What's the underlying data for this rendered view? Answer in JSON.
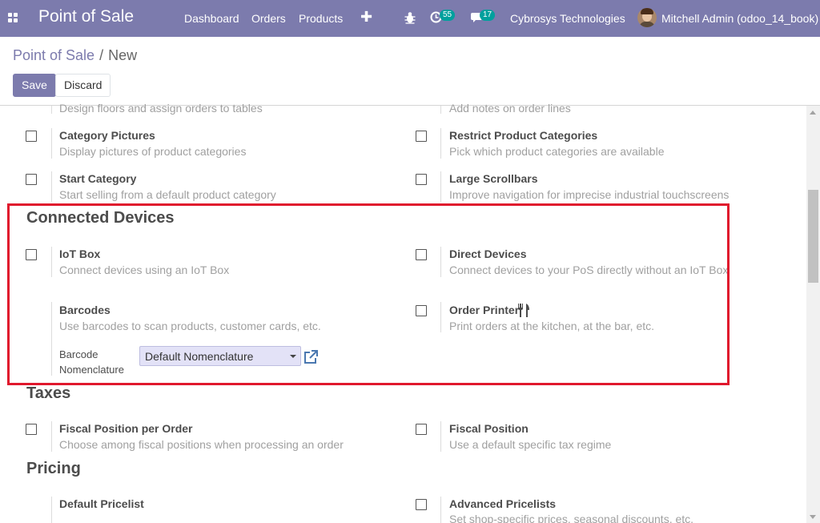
{
  "navbar": {
    "brand": "Point of Sale",
    "menu": [
      "Dashboard",
      "Orders",
      "Products"
    ],
    "activity_count": "55",
    "message_count": "17",
    "company": "Cybrosys Technologies",
    "user": "Mitchell Admin (odoo_14_book)"
  },
  "breadcrumb": {
    "parent": "Point of Sale",
    "separator": "/",
    "current": "New"
  },
  "buttons": {
    "save": "Save",
    "discard": "Discard"
  },
  "settings": {
    "floors_desc": "Design floors and assign orders to tables",
    "notes_desc": "Add notes on order lines",
    "category_pictures": {
      "title": "Category Pictures",
      "desc": "Display pictures of product categories"
    },
    "restrict_categories": {
      "title": "Restrict Product Categories",
      "desc": "Pick which product categories are available"
    },
    "start_category": {
      "title": "Start Category",
      "desc": "Start selling from a default product category"
    },
    "large_scrollbars": {
      "title": "Large Scrollbars",
      "desc": "Improve navigation for imprecise industrial touchscreens"
    }
  },
  "connected_devices": {
    "heading": "Connected Devices",
    "iot_box": {
      "title": "IoT Box",
      "desc": "Connect devices using an IoT Box"
    },
    "direct_devices": {
      "title": "Direct Devices",
      "desc": "Connect devices to your PoS directly without an IoT Box"
    },
    "barcodes": {
      "title": "Barcodes",
      "desc": "Use barcodes to scan products, customer cards, etc."
    },
    "order_printer": {
      "title": "Order Printer",
      "desc": "Print orders at the kitchen, at the bar, etc."
    },
    "barcode_nomenclature": {
      "label_line1": "Barcode",
      "label_line2": "Nomenclature",
      "value": "Default Nomenclature"
    }
  },
  "taxes": {
    "heading": "Taxes",
    "fiscal_position_per_order": {
      "title": "Fiscal Position per Order",
      "desc": "Choose among fiscal positions when processing an order"
    },
    "fiscal_position": {
      "title": "Fiscal Position",
      "desc": "Use a default specific tax regime"
    }
  },
  "pricing": {
    "heading": "Pricing",
    "default_pricelist": {
      "title": "Default Pricelist"
    },
    "advanced_pricelists": {
      "title": "Advanced Pricelists",
      "desc": "Set shop-specific prices, seasonal discounts, etc."
    }
  },
  "colors": {
    "brand": "#7c7bad",
    "badge": "#00a09d",
    "highlight": "#e0182d",
    "select_bg": "#e3e2f7"
  }
}
